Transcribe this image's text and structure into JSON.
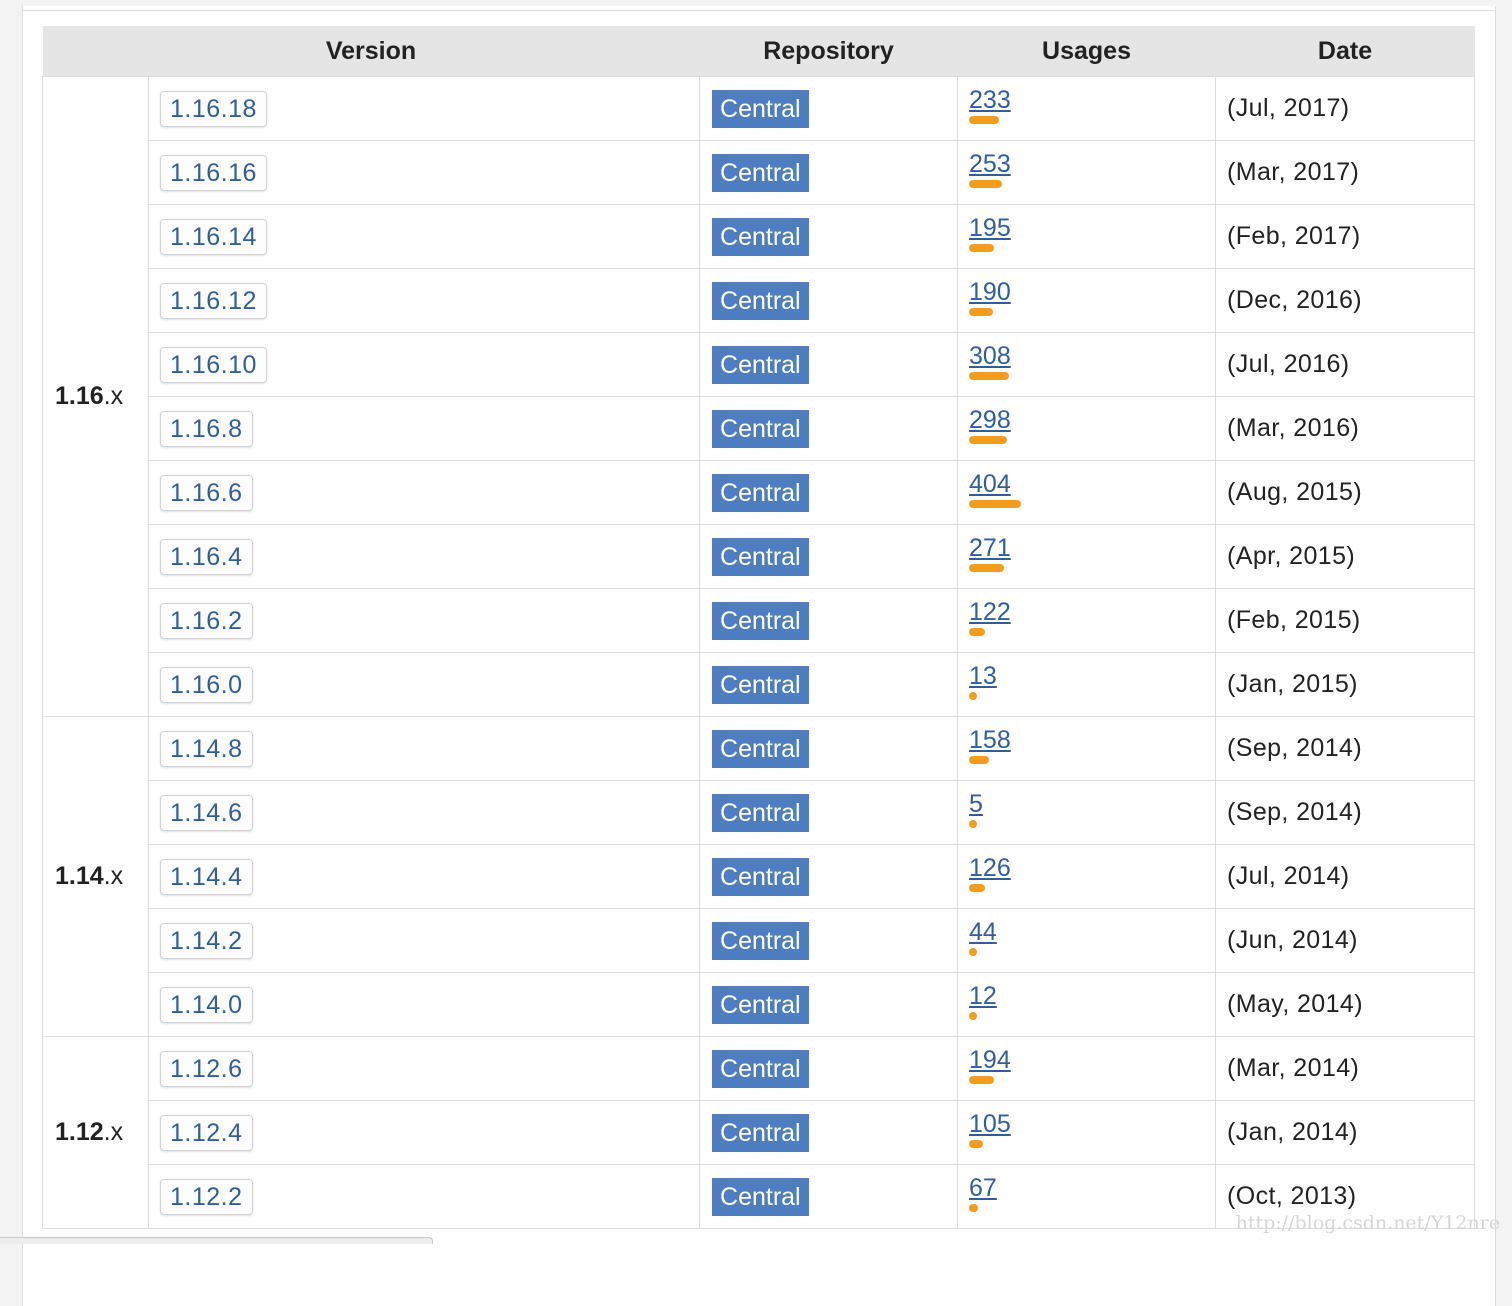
{
  "table": {
    "headers": {
      "version": "Version",
      "repository": "Repository",
      "usages": "Usages",
      "date": "Date"
    },
    "max_usage": 404,
    "groups": [
      {
        "major": "1.16",
        "suffix": ".x",
        "rows": [
          {
            "version": "1.16.18",
            "repository": "Central",
            "usages": "233",
            "date": "(Jul, 2017)"
          },
          {
            "version": "1.16.16",
            "repository": "Central",
            "usages": "253",
            "date": "(Mar, 2017)"
          },
          {
            "version": "1.16.14",
            "repository": "Central",
            "usages": "195",
            "date": "(Feb, 2017)"
          },
          {
            "version": "1.16.12",
            "repository": "Central",
            "usages": "190",
            "date": "(Dec, 2016)"
          },
          {
            "version": "1.16.10",
            "repository": "Central",
            "usages": "308",
            "date": "(Jul, 2016)"
          },
          {
            "version": "1.16.8",
            "repository": "Central",
            "usages": "298",
            "date": "(Mar, 2016)"
          },
          {
            "version": "1.16.6",
            "repository": "Central",
            "usages": "404",
            "date": "(Aug, 2015)"
          },
          {
            "version": "1.16.4",
            "repository": "Central",
            "usages": "271",
            "date": "(Apr, 2015)"
          },
          {
            "version": "1.16.2",
            "repository": "Central",
            "usages": "122",
            "date": "(Feb, 2015)"
          },
          {
            "version": "1.16.0",
            "repository": "Central",
            "usages": "13",
            "date": "(Jan, 2015)"
          }
        ]
      },
      {
        "major": "1.14",
        "suffix": ".x",
        "rows": [
          {
            "version": "1.14.8",
            "repository": "Central",
            "usages": "158",
            "date": "(Sep, 2014)"
          },
          {
            "version": "1.14.6",
            "repository": "Central",
            "usages": "5",
            "date": "(Sep, 2014)"
          },
          {
            "version": "1.14.4",
            "repository": "Central",
            "usages": "126",
            "date": "(Jul, 2014)"
          },
          {
            "version": "1.14.2",
            "repository": "Central",
            "usages": "44",
            "date": "(Jun, 2014)"
          },
          {
            "version": "1.14.0",
            "repository": "Central",
            "usages": "12",
            "date": "(May, 2014)"
          }
        ]
      },
      {
        "major": "1.12",
        "suffix": ".x",
        "rows": [
          {
            "version": "1.12.6",
            "repository": "Central",
            "usages": "194",
            "date": "(Mar, 2014)"
          },
          {
            "version": "1.12.4",
            "repository": "Central",
            "usages": "105",
            "date": "(Jan, 2014)"
          },
          {
            "version": "1.12.2",
            "repository": "Central",
            "usages": "67",
            "date": "(Oct, 2013)"
          }
        ]
      }
    ]
  },
  "watermark": "http://blog.csdn.net/Y12nre",
  "colors": {
    "badge": "#4f7ec0",
    "link": "#2f5e9c",
    "usage_bar": "#f39c1f",
    "header_bg": "#e5e5e5"
  }
}
